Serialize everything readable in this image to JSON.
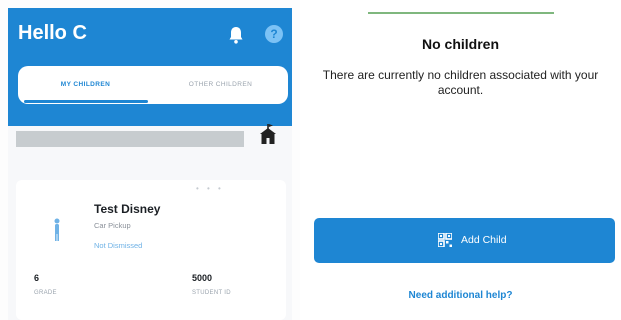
{
  "left": {
    "header": {
      "title": "Hello C"
    },
    "tabs": [
      {
        "label": "MY CHILDREN"
      },
      {
        "label": "OTHER CHILDREN"
      }
    ],
    "child_card": {
      "name": "Test Disney",
      "line1": "Car Pickup",
      "line2": "Not Dismissed",
      "stats": [
        {
          "value": "6",
          "label": "GRADE"
        },
        {
          "value": "5000",
          "label": "STUDENT ID"
        }
      ]
    },
    "icons": {
      "bell": "bell-icon",
      "help": "help-icon",
      "school": "school-icon",
      "child": "child-icon"
    }
  },
  "right": {
    "title": "No children",
    "message": "There are currently no children associated with your account.",
    "add_button": {
      "label": "Add Child",
      "icon": "qr-code-icon"
    },
    "help_link": "Need additional help?"
  },
  "colors": {
    "brand_blue": "#1e86d3",
    "accent_green": "#7fb77e"
  }
}
